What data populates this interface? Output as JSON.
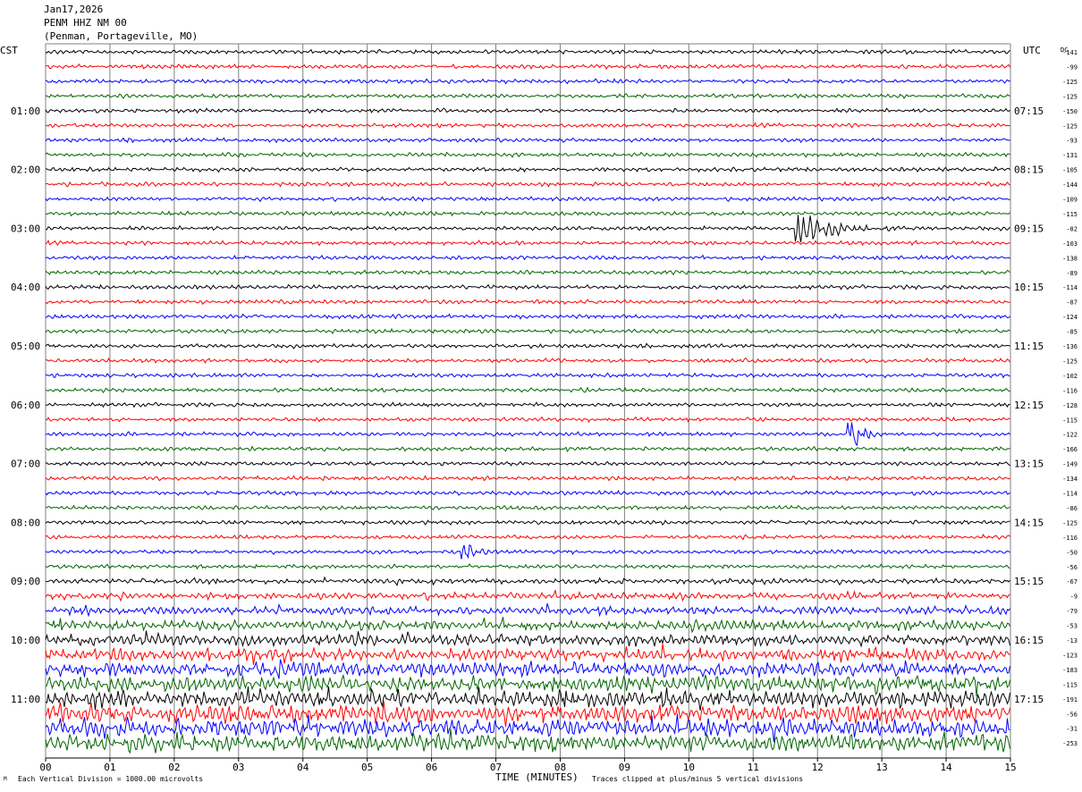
{
  "header": {
    "date": "Jan17,2026",
    "station": "PENM HHZ NM 00",
    "location": "(Penman, Portageville, MO)"
  },
  "labels": {
    "left_tz": "CST",
    "right_tz": "UTC",
    "dc": "DC",
    "footer_left": "Each Vertical Division = 1000.00 microvolts",
    "footer_center": "TIME (MINUTES)",
    "footer_right": "Traces clipped at plus/minus 5 vertical divisions",
    "footer_mark": "M"
  },
  "colors": {
    "trace_cycle": [
      "#000000",
      "#ff0000",
      "#0000ff",
      "#006400"
    ],
    "grid": "#808080"
  },
  "chart_data": {
    "type": "line",
    "title": "PENM HHZ NM 00",
    "xlabel": "TIME (MINUTES)",
    "xlim": [
      0,
      15
    ],
    "x_ticks": [
      "00",
      "01",
      "02",
      "03",
      "04",
      "05",
      "06",
      "07",
      "08",
      "09",
      "10",
      "11",
      "12",
      "13",
      "14",
      "15"
    ],
    "traces_per_hour": 4,
    "trace_count": 48,
    "left_hour_labels": [
      "01:00",
      "02:00",
      "03:00",
      "04:00",
      "05:00",
      "06:00",
      "07:00",
      "08:00",
      "09:00",
      "10:00",
      "11:00"
    ],
    "right_hour_labels": [
      "07:15",
      "08:15",
      "09:15",
      "10:15",
      "11:15",
      "12:15",
      "13:15",
      "14:15",
      "15:15",
      "16:15",
      "17:15"
    ],
    "dc_offsets": [
      -141,
      -99,
      -125,
      -125,
      -150,
      -125,
      -93,
      -131,
      -105,
      -144,
      -109,
      -115,
      -82,
      -103,
      -138,
      -89,
      -114,
      -87,
      -124,
      -85,
      -136,
      -125,
      -102,
      -116,
      -128,
      -115,
      -122,
      -166,
      -149,
      -134,
      -114,
      -86,
      -125,
      -116,
      -50,
      -56,
      -67,
      -9,
      -79,
      -53,
      -13,
      -123,
      -183,
      -115,
      -191,
      -56,
      -31,
      -253
    ],
    "events": [
      {
        "trace": 12,
        "minute": 11.8,
        "amplitude": "large",
        "duration_min": 1.5
      },
      {
        "trace": 26,
        "minute": 12.6,
        "amplitude": "large",
        "duration_min": 0.4
      },
      {
        "trace": 34,
        "minute": 6.6,
        "amplitude": "moderate",
        "duration_min": 0.5
      }
    ]
  }
}
